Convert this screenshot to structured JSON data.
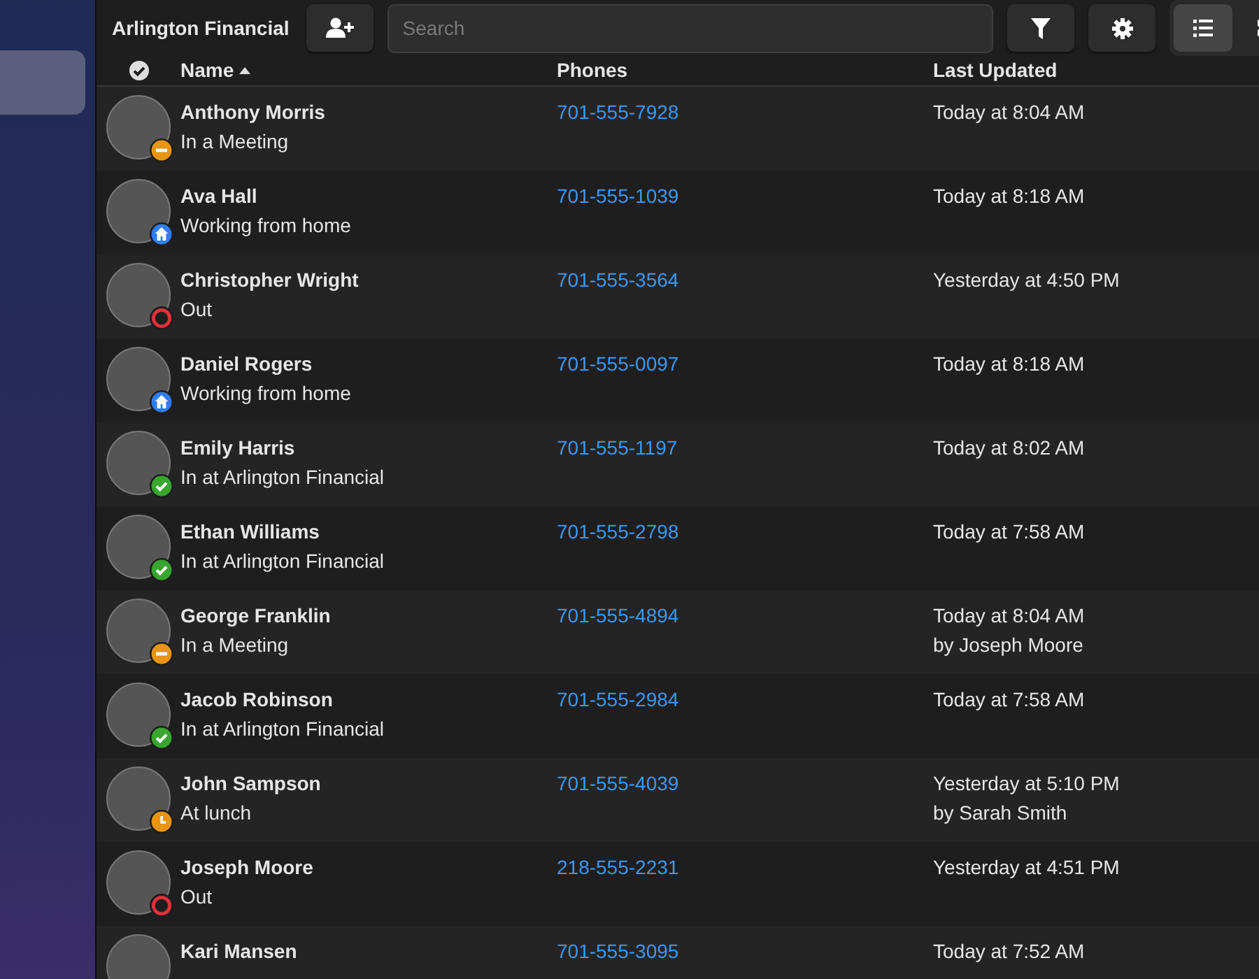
{
  "sidebar": {
    "items": [
      {
        "selected": true
      }
    ]
  },
  "toolbar": {
    "title": "Arlington Financial",
    "search": {
      "placeholder": "Search"
    },
    "views": [
      {
        "kind": "list",
        "selected": true
      },
      {
        "kind": "grid",
        "selected": false
      }
    ]
  },
  "table": {
    "columns": [
      {
        "label": "Name",
        "sorted": true
      },
      {
        "label": "Phones"
      },
      {
        "label": "Last Updated"
      }
    ],
    "rows": [
      {
        "name": "Anthony Morris",
        "kind": "meeting",
        "status_text": "In a Meeting",
        "phone": "701-555-7928",
        "updated": "Today at 8:04 AM"
      },
      {
        "name": "Ava Hall",
        "kind": "home",
        "status_text": "Working from home",
        "phone": "701-555-1039",
        "updated": "Today at 8:18 AM"
      },
      {
        "name": "Christopher Wright",
        "kind": "out",
        "status_text": "Out",
        "phone": "701-555-3564",
        "updated": "Yesterday at 4:50 PM"
      },
      {
        "name": "Daniel Rogers",
        "kind": "home",
        "status_text": "Working from home",
        "phone": "701-555-0097",
        "updated": "Today at 8:18 AM"
      },
      {
        "name": "Emily Harris",
        "kind": "in",
        "status_text": "In at Arlington Financial",
        "phone": "701-555-1197",
        "updated": "Today at 8:02 AM"
      },
      {
        "name": "Ethan Williams",
        "kind": "in",
        "status_text": "In at Arlington Financial",
        "phone": "701-555-2798",
        "updated": "Today at 7:58 AM"
      },
      {
        "name": "George Franklin",
        "kind": "meeting",
        "status_text": "In a Meeting",
        "phone": "701-555-4894",
        "updated": "Today at 8:04 AM",
        "updated_by": "by Joseph Moore"
      },
      {
        "name": "Jacob Robinson",
        "kind": "in",
        "status_text": "In at Arlington Financial",
        "phone": "701-555-2984",
        "updated": "Today at 7:58 AM"
      },
      {
        "name": "John Sampson",
        "kind": "lunch",
        "status_text": "At lunch",
        "phone": "701-555-4039",
        "updated": "Yesterday at 5:10 PM",
        "updated_by": "by Sarah Smith"
      },
      {
        "name": "Joseph Moore",
        "kind": "out",
        "status_text": "Out",
        "phone": "218-555-2231",
        "updated": "Yesterday at 4:51 PM"
      },
      {
        "name": "Kari Mansen",
        "phone": "701-555-3095",
        "updated": "Today at 7:52 AM"
      }
    ]
  }
}
